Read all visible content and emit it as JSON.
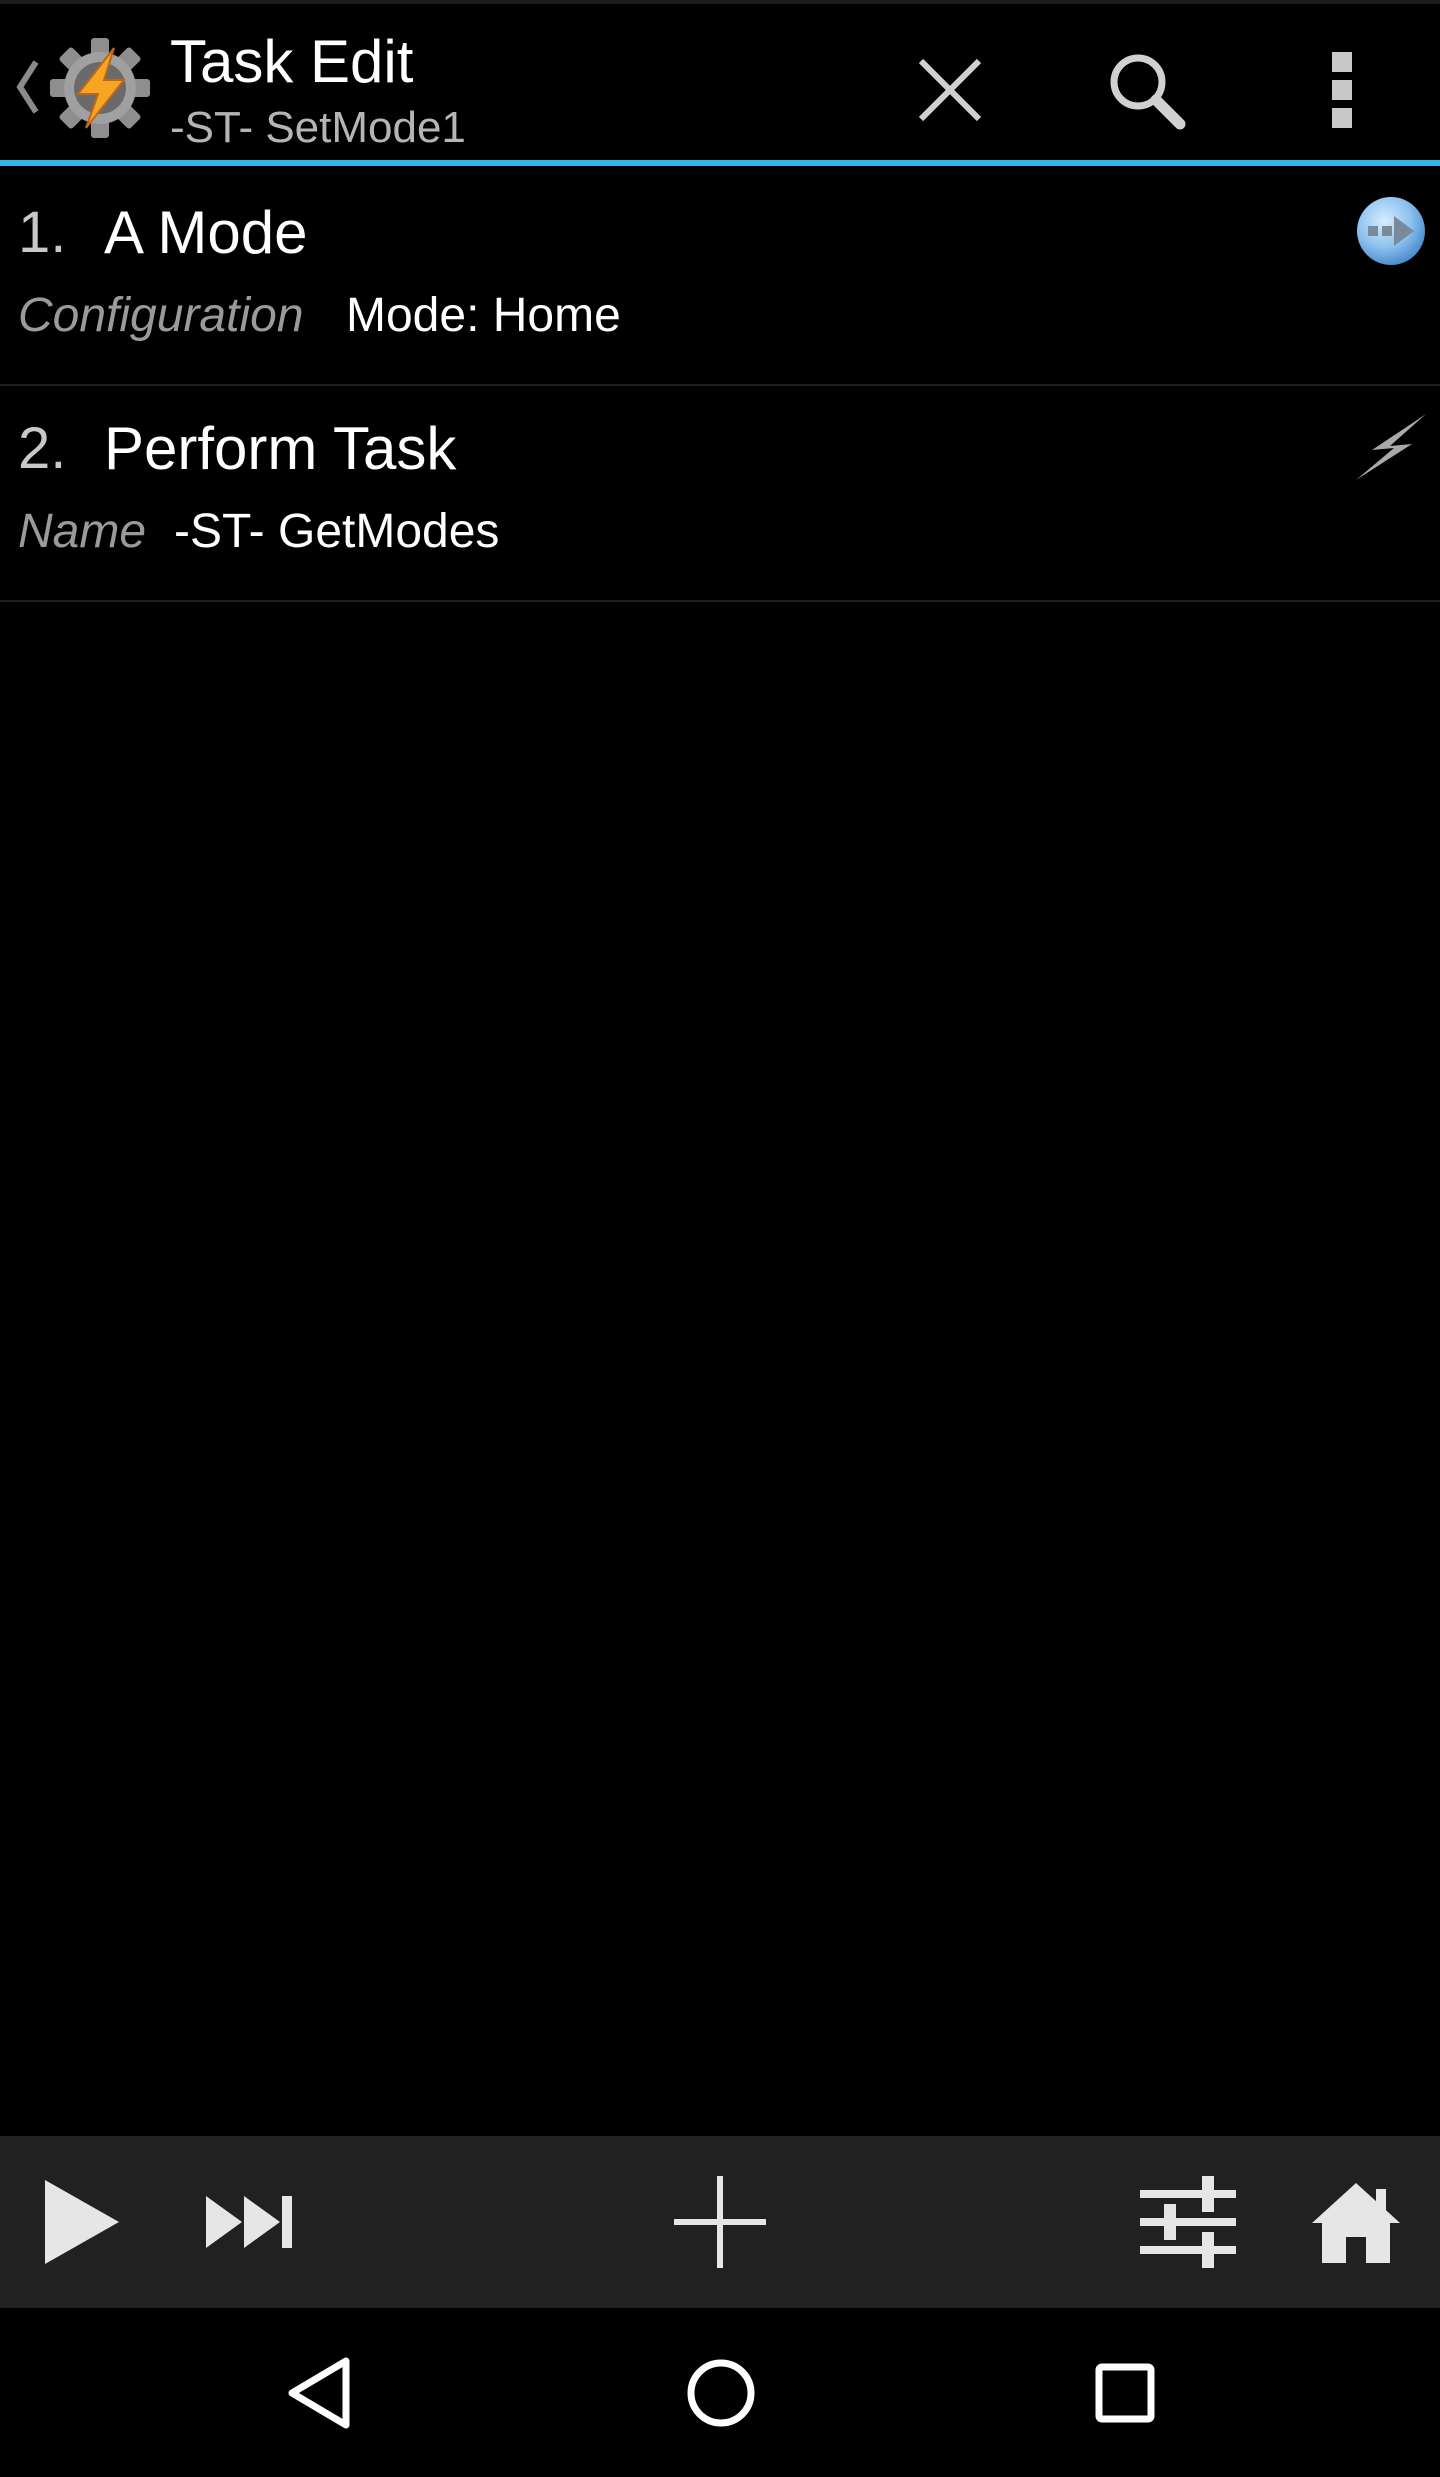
{
  "action_bar": {
    "title": "Task Edit",
    "subtitle": "-ST- SetMode1",
    "accent_color": "#33b5e5",
    "icons": {
      "back": "chevron-left-icon",
      "logo": "tasker-gear-bolt-icon",
      "close": "close-icon",
      "search": "search-icon",
      "overflow": "overflow-menu-icon"
    }
  },
  "actions": [
    {
      "number": "1.",
      "name": "A Mode",
      "param_label": "Configuration",
      "param_value": "Mode: Home",
      "icon": "plugin-arrow-icon"
    },
    {
      "number": "2.",
      "name": "Perform Task",
      "param_label": "Name",
      "param_value": "-ST- GetModes",
      "icon": "lightning-bolt-icon"
    }
  ],
  "bottom_toolbar": {
    "icons": [
      "play-icon",
      "step-forward-icon",
      "add-icon",
      "settings-sliders-icon",
      "home-icon"
    ]
  },
  "nav_bar": {
    "icons": [
      "nav-back-icon",
      "nav-home-icon",
      "nav-recents-icon"
    ]
  }
}
